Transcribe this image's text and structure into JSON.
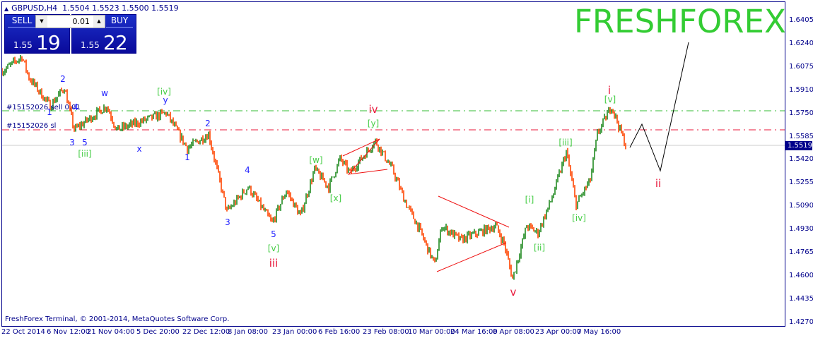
{
  "symbol": {
    "name": "GBPUSD,H4",
    "ohlc": "1.5504 1.5523 1.5500 1.5519"
  },
  "trade_panel": {
    "sell_label": "SELL",
    "buy_label": "BUY",
    "lot": "0.01",
    "sell_prefix": "1.55",
    "sell_big": "19",
    "buy_prefix": "1.55",
    "buy_big": "22"
  },
  "watermark": "FRESHFOREX",
  "copyright": "FreshForex Terminal, © 2001-2014, MetaQuotes Software Corp.",
  "order_lines": [
    {
      "label": "#15152026 sell 0.01",
      "price": 1.575,
      "color": "#33bb33"
    },
    {
      "label": "#15152026 sl",
      "price": 1.5617,
      "color": "#e8173a"
    }
  ],
  "current_price": "1.5519",
  "colors": {
    "bull": "#228b22",
    "bear": "#ff4500",
    "axis": "#00008b",
    "wave_blue": "#2020ff",
    "wave_green": "#44cc44",
    "wave_red": "#e8173a"
  },
  "chart_data": {
    "type": "candlestick",
    "y_ticks": [
      "1.6405",
      "1.6240",
      "1.6075",
      "1.5910",
      "1.5750",
      "1.5585",
      "1.5420",
      "1.5255",
      "1.5090",
      "1.4930",
      "1.4765",
      "1.4600",
      "1.4435",
      "1.4270"
    ],
    "ylim": [
      1.427,
      1.6405
    ],
    "x_ticks": [
      "22 Oct 2014",
      "6 Nov 12:00",
      "21 Nov 04:00",
      "5 Dec 20:00",
      "22 Dec 12:00",
      "8 Jan 08:00",
      "23 Jan 00:00",
      "6 Feb 16:00",
      "23 Feb 08:00",
      "10 Mar 00:00",
      "24 Mar 16:00",
      "8 Apr 08:00",
      "23 Apr 00:00",
      "7 May 16:00"
    ],
    "price_path": [
      [
        1,
        1.605
      ],
      [
        14,
        1.615
      ],
      [
        19,
        1.6
      ],
      [
        34,
        1.58
      ],
      [
        44,
        1.593
      ],
      [
        51,
        1.563
      ],
      [
        74,
        1.58
      ],
      [
        81,
        1.563
      ],
      [
        116,
        1.575
      ],
      [
        131,
        1.55
      ],
      [
        146,
        1.56
      ],
      [
        159,
        1.505
      ],
      [
        174,
        1.5225
      ],
      [
        191,
        1.497
      ],
      [
        201,
        1.52
      ],
      [
        211,
        1.502
      ],
      [
        221,
        1.535
      ],
      [
        231,
        1.5225
      ],
      [
        239,
        1.5425
      ],
      [
        246,
        1.5325
      ],
      [
        264,
        1.555
      ],
      [
        276,
        1.535
      ],
      [
        286,
        1.51
      ],
      [
        294,
        1.495
      ],
      [
        306,
        1.4675
      ],
      [
        311,
        1.495
      ],
      [
        324,
        1.485
      ],
      [
        349,
        1.495
      ],
      [
        355,
        1.4825
      ],
      [
        361,
        1.4575
      ],
      [
        371,
        1.495
      ],
      [
        379,
        1.49
      ],
      [
        389,
        1.515
      ],
      [
        399,
        1.5475
      ],
      [
        406,
        1.51
      ],
      [
        416,
        1.5275
      ],
      [
        421,
        1.56
      ],
      [
        431,
        1.58
      ],
      [
        441,
        1.5519
      ]
    ],
    "wave_labels": [
      {
        "text": "1",
        "color": "blue"
      },
      {
        "text": "2",
        "color": "blue"
      },
      {
        "text": "3",
        "color": "blue"
      },
      {
        "text": "4",
        "color": "blue"
      },
      {
        "text": "5",
        "color": "blue"
      },
      {
        "text": "1",
        "color": "blue"
      },
      {
        "text": "2",
        "color": "blue"
      },
      {
        "text": "3",
        "color": "blue"
      },
      {
        "text": "4",
        "color": "blue"
      },
      {
        "text": "5",
        "color": "blue"
      },
      {
        "text": "w",
        "color": "blue"
      },
      {
        "text": "y",
        "color": "blue"
      },
      {
        "text": "x",
        "color": "blue"
      },
      {
        "text": "[iii]",
        "color": "green"
      },
      {
        "text": "[iv]",
        "color": "green"
      },
      {
        "text": "[v]",
        "color": "green"
      },
      {
        "text": "[w]",
        "color": "green"
      },
      {
        "text": "[x]",
        "color": "green"
      },
      {
        "text": "[y]",
        "color": "green"
      },
      {
        "text": "[i]",
        "color": "green"
      },
      {
        "text": "[ii]",
        "color": "green"
      },
      {
        "text": "[iii]",
        "color": "green"
      },
      {
        "text": "[iv]",
        "color": "green"
      },
      {
        "text": "[v]",
        "color": "green"
      },
      {
        "text": "iii",
        "color": "red"
      },
      {
        "text": "iv",
        "color": "red"
      },
      {
        "text": "v",
        "color": "red"
      },
      {
        "text": "i",
        "color": "red"
      },
      {
        "text": "ii",
        "color": "red"
      }
    ]
  }
}
